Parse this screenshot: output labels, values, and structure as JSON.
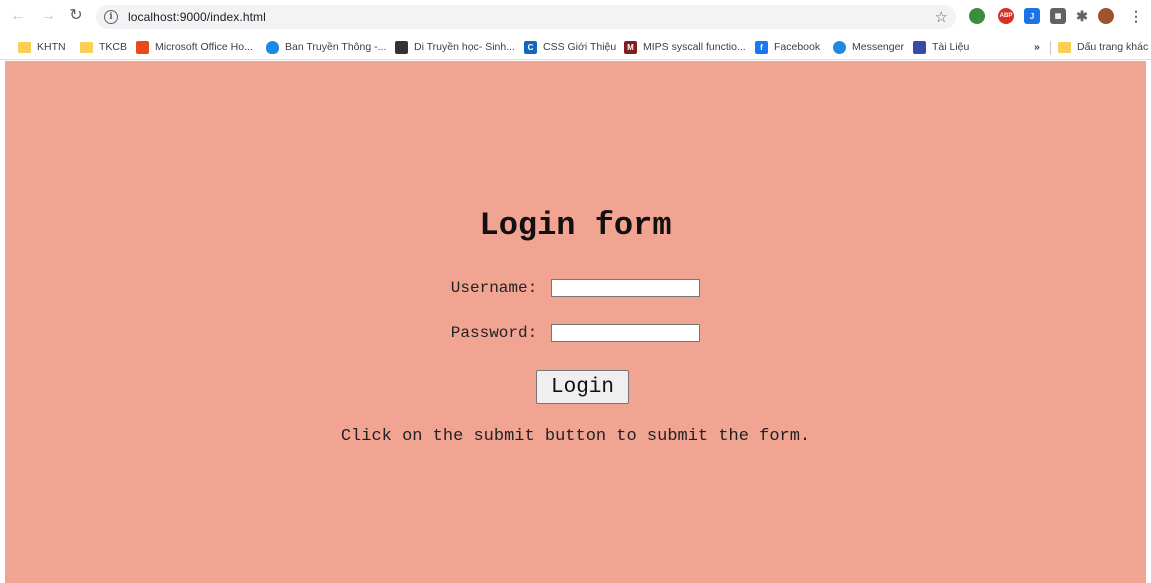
{
  "browser": {
    "url": "localhost:9000/index.html"
  },
  "bookmarks": [
    {
      "label": "KHTN",
      "icon": "folder-icon"
    },
    {
      "label": "TKCB",
      "icon": "folder-icon"
    },
    {
      "label": "Microsoft Office Ho...",
      "icon": "office-icon"
    },
    {
      "label": "Ban Truyền Thông -...",
      "icon": "cloud-icon"
    },
    {
      "label": "Di Truyền học- Sinh...",
      "icon": "slides-icon"
    },
    {
      "label": "CSS Giới Thiệu",
      "icon": "css-icon"
    },
    {
      "label": "MIPS syscall functio...",
      "icon": "mips-icon"
    },
    {
      "label": "Facebook",
      "icon": "facebook-icon"
    },
    {
      "label": "Messenger",
      "icon": "messenger-icon"
    },
    {
      "label": "Tài Liệu",
      "icon": "docs-icon"
    }
  ],
  "overflow_label": "»",
  "other_bookmarks": "Dấu trang khác",
  "form": {
    "title": "Login form",
    "username_label": "Username:",
    "username_value": "",
    "password_label": "Password:",
    "password_value": "",
    "login_button": "Login",
    "hint": "Click on the submit button to submit the form."
  },
  "colors": {
    "page_background": "#f2a493"
  }
}
